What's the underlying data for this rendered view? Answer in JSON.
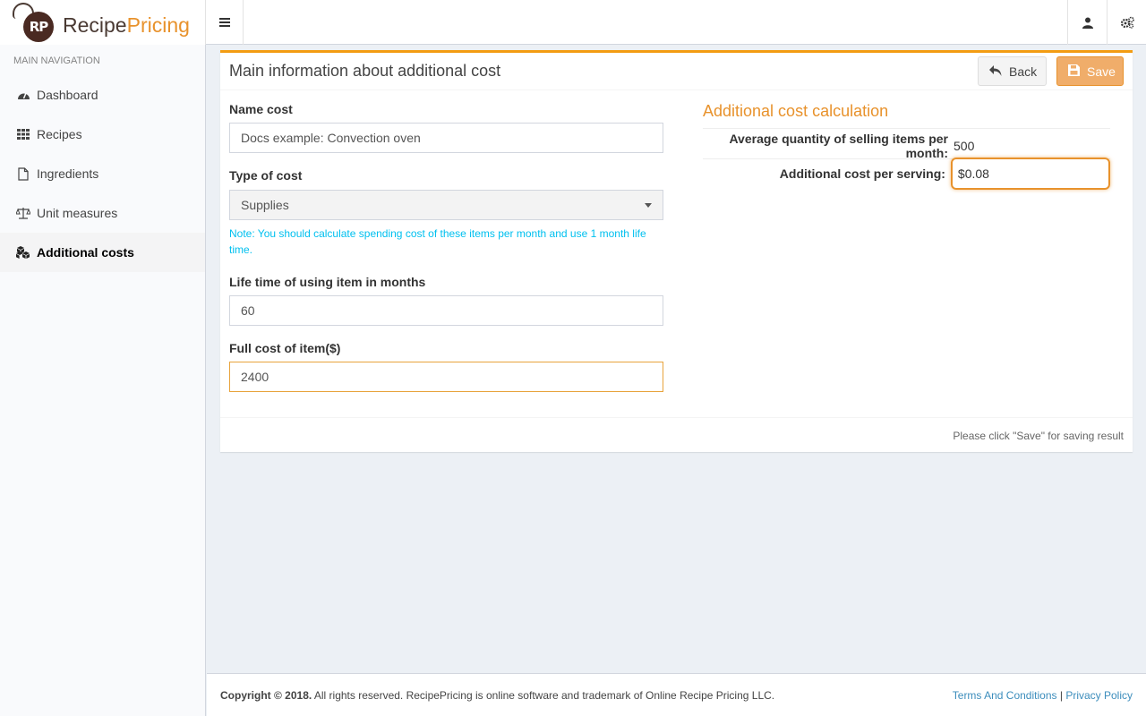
{
  "brand": {
    "logo_initials": "RP",
    "name_part1": "Recipe",
    "name_part2": "Pricing"
  },
  "header": {
    "menu_icon": "hamburger-icon",
    "user_icon": "user-icon",
    "settings_icon": "gears-icon"
  },
  "sidebar": {
    "header": "MAIN NAVIGATION",
    "items": [
      {
        "label": "Dashboard",
        "icon": "dashboard-icon"
      },
      {
        "label": "Recipes",
        "icon": "grid-icon"
      },
      {
        "label": "Ingredients",
        "icon": "file-icon"
      },
      {
        "label": "Unit measures",
        "icon": "scale-icon"
      },
      {
        "label": "Additional costs",
        "icon": "cubes-icon",
        "active": true
      }
    ]
  },
  "box": {
    "title": "Main information about additional cost",
    "back_label": "Back",
    "save_label": "Save",
    "footer_note": "Please click \"Save\" for saving result"
  },
  "form": {
    "name_label": "Name cost",
    "name_value": "Docs example: Convection oven",
    "type_label": "Type of cost",
    "type_value": "Supplies",
    "note": "Note: You should calculate spending cost of these items per month and use 1 month life time.",
    "lifetime_label": "Life time of using item in months",
    "lifetime_value": "60",
    "fullcost_label": "Full cost of item($)",
    "fullcost_value": "2400"
  },
  "calc": {
    "title": "Additional cost calculation",
    "avg_label": "Average quantity of selling items per month:",
    "avg_value": "500",
    "per_serving_label": "Additional cost per serving:",
    "per_serving_value": "$0.08"
  },
  "footer": {
    "copyright_bold": "Copyright © 2018.",
    "copyright_rest": " All rights reserved. RecipePricing is online software and trademark of Online Recipe Pricing LLC.",
    "terms": "Terms And Conditions",
    "separator": "|",
    "privacy": "Privacy Policy"
  },
  "colors": {
    "accent": "#e8922c",
    "note": "#00c0ef",
    "link": "#3c8dbc"
  }
}
